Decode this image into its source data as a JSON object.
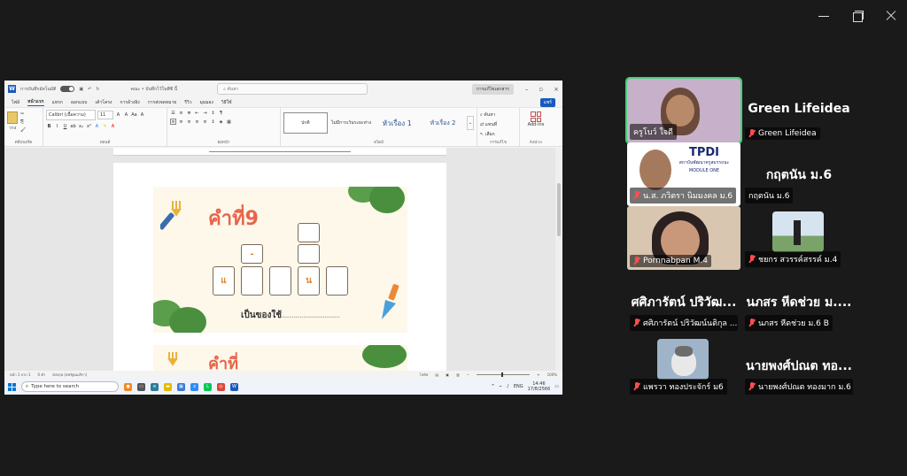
{
  "window": {
    "min": "minimize",
    "max": "restore",
    "close": "close"
  },
  "word": {
    "autosave": "การบันทึกอัตโนมัติ",
    "doc_title": "คณะ • บันทึกไว้ในพีซี นี้",
    "search_placeholder": "ค้นหา",
    "edit_mode": "การแก้ไขเอกสาร",
    "menu": [
      "ไฟล์",
      "หน้าแรก",
      "แทรก",
      "ออกแบบ",
      "เค้าโครง",
      "การอ้างอิง",
      "การส่งจดหมาย",
      "รีวิว",
      "มุมมอง",
      "วิธีใช้"
    ],
    "share": "แชร์",
    "ribbon": {
      "paste": "วาง",
      "clipboard": "คลิปบอร์ด",
      "font_name": "Calibri (เนื้อความ)",
      "font_size": "11",
      "font": "ฟอนต์",
      "paragraph": "ย่อหน้า",
      "styles_label": "สไตล์",
      "styles": [
        "ปกติ",
        "ไม่มีการเว้นระยะห่าง",
        "หัวเรื่อง 1",
        "หัวเรื่อง 2"
      ],
      "find": "ค้นหา",
      "replace": "แทนที่",
      "select": "เลือก",
      "editing": "การแก้ไข",
      "addins": "Add-ins",
      "addins_label": "Add-in"
    },
    "worksheet": {
      "title": "คำที่9",
      "letters": [
        "แ",
        "",
        "",
        "น",
        ""
      ],
      "upper_mark": "-",
      "hint": "เป็นของใช้",
      "dots": "..............................",
      "next_title": "คำที่"
    },
    "status": {
      "page": "หน้า 1 จาก 1",
      "words": "0 คำ",
      "lang": "อังกฤษ (สหรัฐอเมริกา)",
      "focus": "โฟกัส",
      "zoom": "100%"
    }
  },
  "taskbar": {
    "search": "Type here to search",
    "lang": "ENG",
    "time": "14:46",
    "date": "17/8/2566"
  },
  "participants": [
    {
      "name": "ครูโบว์ ใจดี",
      "type": "video"
    },
    {
      "name": "Green Lifeidea",
      "display": "Green Lifeidea",
      "type": "name"
    },
    {
      "name": "น.ส. ภวิตรา นิมมงคล ม.6",
      "type": "video"
    },
    {
      "name": "กฤตนัน ม.6",
      "display": "กฤตนัน ม.6",
      "type": "name"
    },
    {
      "name": "Pornnabpan M.4",
      "type": "video"
    },
    {
      "name": "ชยกร สวรรค์สรรค์ ม.4",
      "type": "avatar"
    },
    {
      "name": "ศศิภารัตน์ ปริวัฒน์นติกุล ...",
      "display": "ศศิภารัตน์ ปริวัฒ...",
      "type": "name"
    },
    {
      "name": "นภสร หีดช่วย ม.6 B",
      "display": "นภสร หีดช่วย ม....",
      "type": "name"
    },
    {
      "name": "แพรวา ทองประจักร์ ม6",
      "type": "avatar"
    },
    {
      "name": "นายพงศ์ปณต ทองมาก ม.6",
      "display": "นายพงศ์ปณต ทอ...",
      "type": "name"
    }
  ],
  "tpdi": {
    "logo": "TPDI",
    "sub": "สถาบันพัฒนาครูสมรรถนะ",
    "module": "MODULE ONE"
  }
}
